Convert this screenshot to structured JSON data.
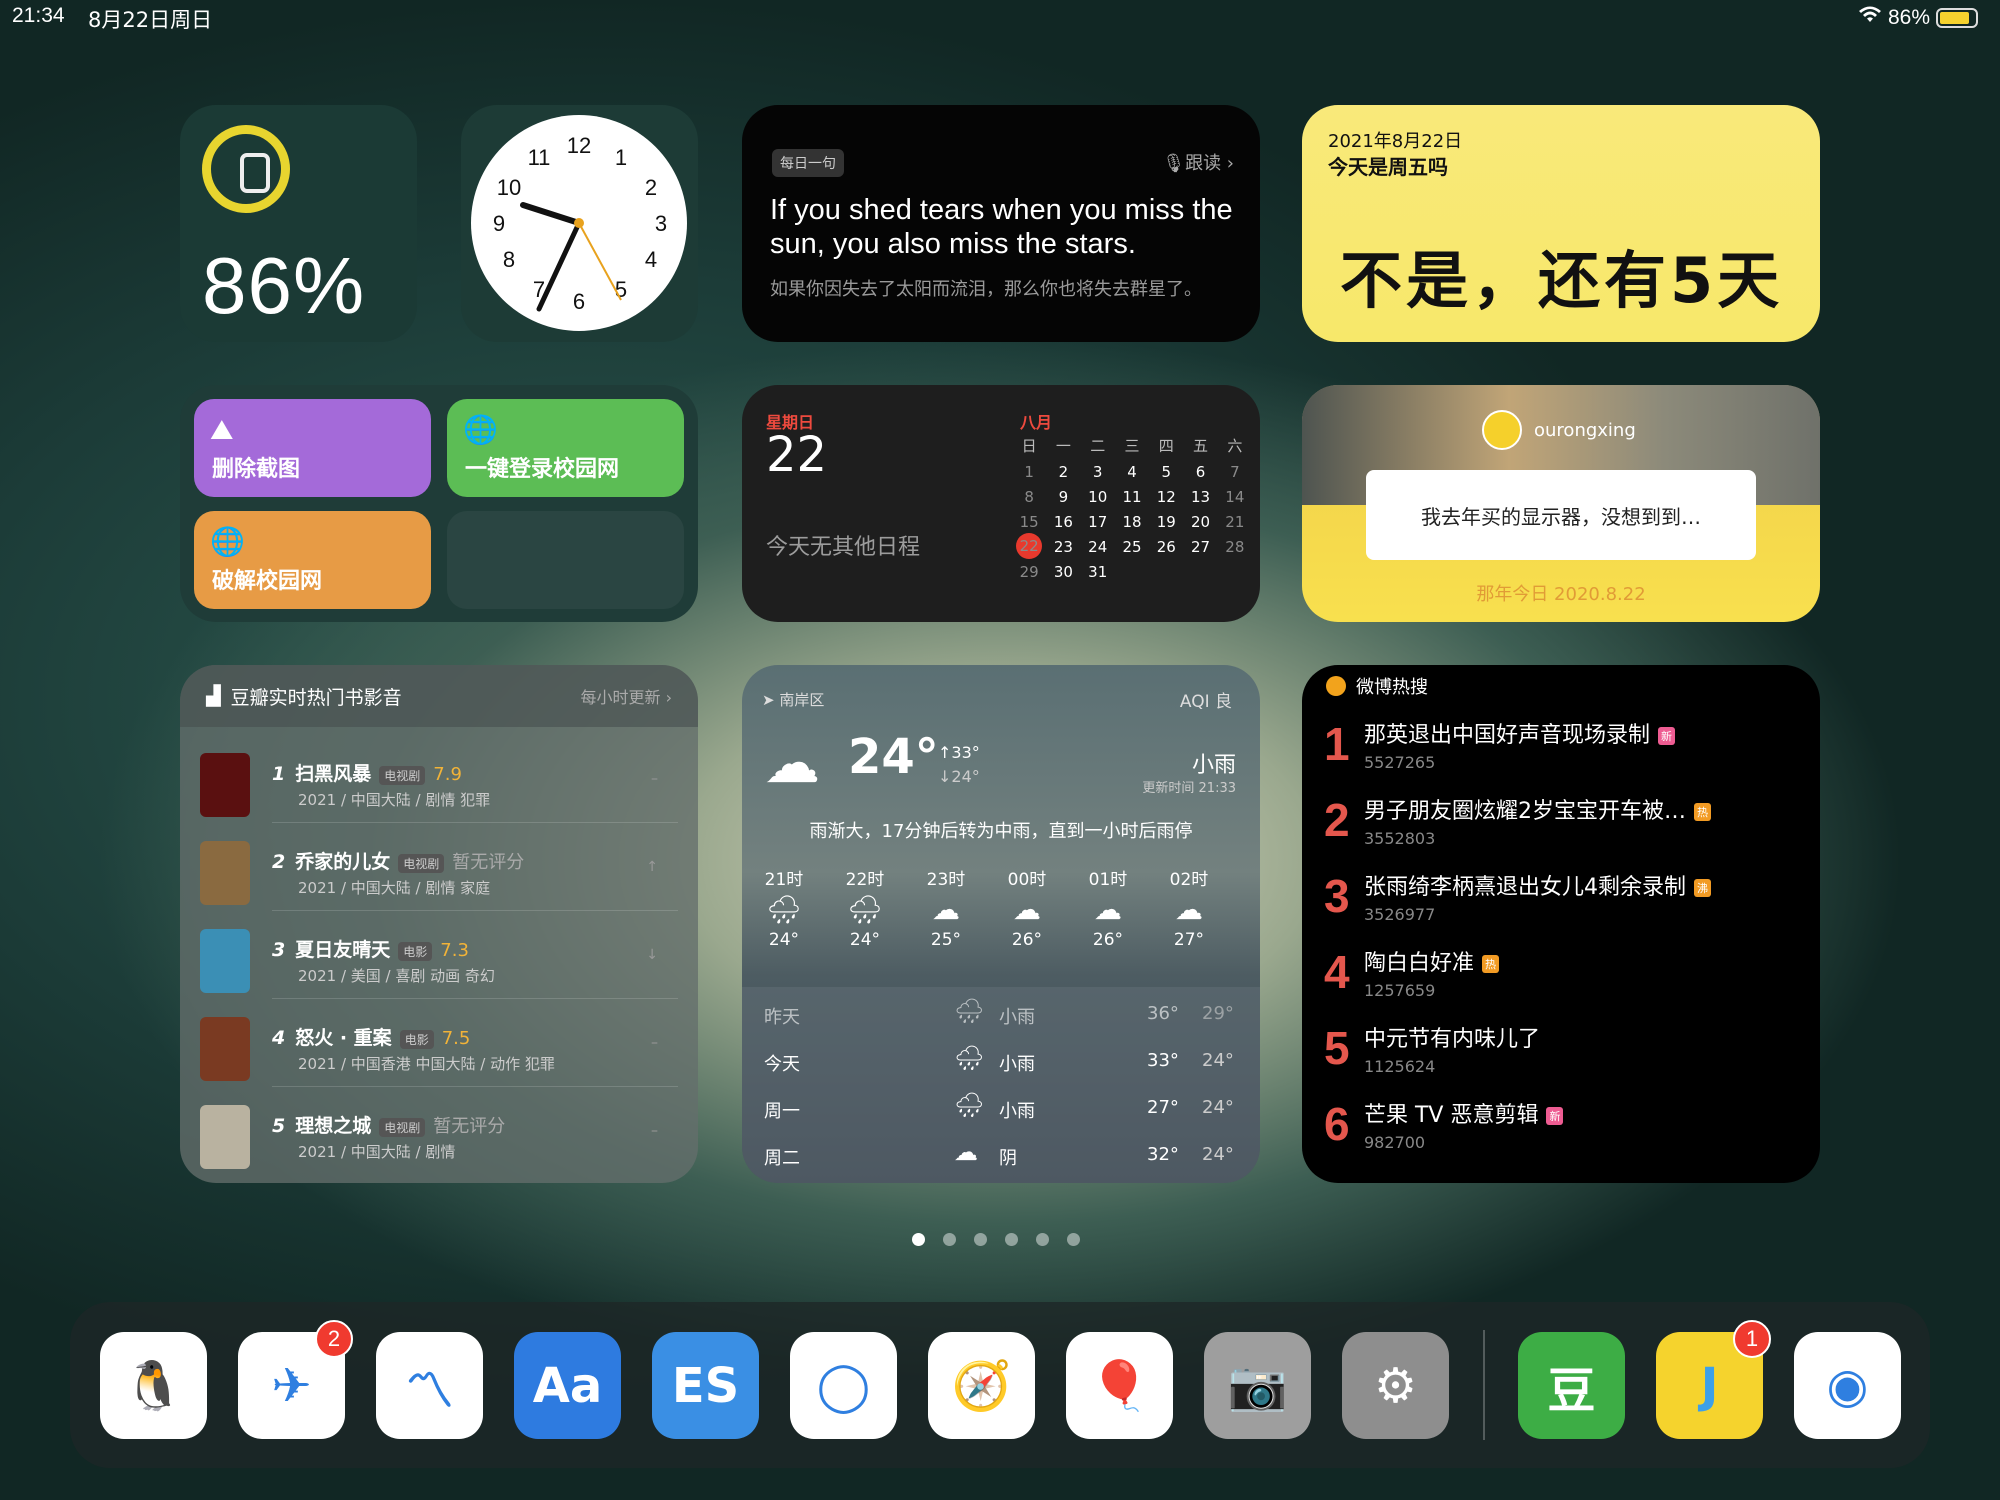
{
  "status": {
    "time": "21:34",
    "date": "8月22日周日",
    "battery": "86%"
  },
  "battery_widget": {
    "percent": "86%",
    "level": 0.86
  },
  "quote_widget": {
    "tag": "每日一句",
    "follow": "跟读 ›",
    "english": "If you shed tears when you miss the sun, you also miss the stars.",
    "chinese": "如果你因失去了太阳而流泪，那么你也将失去群星了。"
  },
  "friday_widget": {
    "date": "2021年8月22日",
    "question": "今天是周五吗",
    "answer": "不是，还有5天"
  },
  "shortcuts": [
    {
      "label": "删除截图",
      "icon": "mountain-icon",
      "color": "#a46ad9"
    },
    {
      "label": "一键登录校园网",
      "icon": "globe-icon",
      "color": "#5cbd55"
    },
    {
      "label": "破解校园网",
      "icon": "globe-icon",
      "color": "#e79b45"
    }
  ],
  "calendar": {
    "weekday": "星期日",
    "day": "22",
    "no_events": "今天无其他日程",
    "month": "八月",
    "headers": [
      "日",
      "一",
      "二",
      "三",
      "四",
      "五",
      "六"
    ],
    "days": [
      "1",
      "2",
      "3",
      "4",
      "5",
      "6",
      "7",
      "8",
      "9",
      "10",
      "11",
      "12",
      "13",
      "14",
      "15",
      "16",
      "17",
      "18",
      "19",
      "20",
      "21",
      "22",
      "23",
      "24",
      "25",
      "26",
      "27",
      "28",
      "29",
      "30",
      "31"
    ],
    "today": "22"
  },
  "photo_widget": {
    "user": "ourongxing",
    "text": "我去年买的显示器，没想到到…",
    "footer": "那年今日 2020.8.22"
  },
  "douban": {
    "title": "豆瓣实时热门书影音",
    "update": "每小时更新 ›",
    "items": [
      {
        "rank": "1",
        "title": "扫黑风暴",
        "type": "电视剧",
        "score": "7.9",
        "sub": "2021 / 中国大陆 / 剧情 犯罪",
        "trend": "–",
        "color": "#5a1010"
      },
      {
        "rank": "2",
        "title": "乔家的儿女",
        "type": "电视剧",
        "score": "暂无评分",
        "sub": "2021 / 中国大陆 / 剧情 家庭",
        "trend": "↑",
        "color": "#8a6a40"
      },
      {
        "rank": "3",
        "title": "夏日友晴天",
        "type": "电影",
        "score": "7.3",
        "sub": "2021 / 美国 / 喜剧 动画 奇幻",
        "trend": "↓",
        "color": "#3b8fb5"
      },
      {
        "rank": "4",
        "title": "怒火 · 重案",
        "type": "电影",
        "score": "7.5",
        "sub": "2021 / 中国香港 中国大陆 / 动作 犯罪",
        "trend": "–",
        "color": "#7a3a22"
      },
      {
        "rank": "5",
        "title": "理想之城",
        "type": "电视剧",
        "score": "暂无评分",
        "sub": "2021 / 中国大陆 / 剧情",
        "trend": "–",
        "color": "#b9b2a0"
      }
    ]
  },
  "weather": {
    "location": "南岸区",
    "aqi": "AQI 良",
    "temp": "24°",
    "high": "↑33°",
    "low": "↓24°",
    "condition": "小雨",
    "updated": "更新时间 21:33",
    "description": "雨渐大，17分钟后转为中雨，直到一小时后雨停",
    "hourly": [
      {
        "time": "21时",
        "temp": "24°",
        "icon": "rain-icon"
      },
      {
        "time": "22时",
        "temp": "24°",
        "icon": "rain-icon"
      },
      {
        "time": "23时",
        "temp": "25°",
        "icon": "cloud-icon"
      },
      {
        "time": "00时",
        "temp": "26°",
        "icon": "cloud-icon"
      },
      {
        "time": "01时",
        "temp": "26°",
        "icon": "cloud-icon"
      },
      {
        "time": "02时",
        "temp": "27°",
        "icon": "cloud-icon"
      }
    ],
    "daily": [
      {
        "name": "昨天",
        "cond": "小雨",
        "high": "36°",
        "low": "29°",
        "icon": "rain-icon"
      },
      {
        "name": "今天",
        "cond": "小雨",
        "high": "33°",
        "low": "24°",
        "icon": "rain-icon"
      },
      {
        "name": "周一",
        "cond": "小雨",
        "high": "27°",
        "low": "24°",
        "icon": "rain-icon"
      },
      {
        "name": "周二",
        "cond": "阴",
        "high": "32°",
        "low": "24°",
        "icon": "cloud-icon"
      }
    ]
  },
  "weibo": {
    "title": "微博热搜",
    "items": [
      {
        "rank": "1",
        "title": "那英退出中国好声音现场录制",
        "tag": "新",
        "tag_color": "#ee5c92",
        "count": "5527265"
      },
      {
        "rank": "2",
        "title": "男子朋友圈炫耀2岁宝宝开车被…",
        "tag": "热",
        "tag_color": "#f29b24",
        "count": "3552803"
      },
      {
        "rank": "3",
        "title": "张雨绮李柄熹退出女儿4剩余录制",
        "tag": "沸",
        "tag_color": "#f29b24",
        "count": "3526977"
      },
      {
        "rank": "4",
        "title": "陶白白好准",
        "tag": "热",
        "tag_color": "#f29b24",
        "count": "1257659"
      },
      {
        "rank": "5",
        "title": "中元节有内味儿了",
        "tag": "",
        "tag_color": "",
        "count": "1125624"
      },
      {
        "rank": "6",
        "title": "芒果 TV 恶意剪辑",
        "tag": "新",
        "tag_color": "#ee5c92",
        "count": "982700"
      }
    ]
  },
  "page_dots": {
    "count": 6,
    "active": 0
  },
  "dock": [
    {
      "name": "qq-app",
      "icon": "penguin-icon",
      "bg": "#ffffff",
      "glyph": "🐧",
      "badge": ""
    },
    {
      "name": "telegram-app",
      "icon": "paper-plane-icon",
      "bg": "#ffffff",
      "glyph": "✈",
      "badge": "2"
    },
    {
      "name": "app-3",
      "icon": "m-logo-icon",
      "bg": "#ffffff",
      "glyph": "〽",
      "badge": ""
    },
    {
      "name": "dictionary-app",
      "icon": "aa-search-icon",
      "bg": "#2e7be0",
      "glyph": "Aa",
      "badge": ""
    },
    {
      "name": "es-file-app",
      "icon": "folder-cloud-icon",
      "bg": "#3a8fe4",
      "glyph": "ES",
      "badge": ""
    },
    {
      "name": "app-6",
      "icon": "ring-icon",
      "bg": "#ffffff",
      "glyph": "◯",
      "badge": ""
    },
    {
      "name": "safari-app",
      "icon": "compass-icon",
      "bg": "#ffffff",
      "glyph": "🧭",
      "badge": ""
    },
    {
      "name": "app-8",
      "icon": "balloon-icon",
      "bg": "#ffffff",
      "glyph": "🎈",
      "badge": ""
    },
    {
      "name": "camera-app",
      "icon": "camera-icon",
      "bg": "#9e9e9e",
      "glyph": "📷",
      "badge": ""
    },
    {
      "name": "settings-app",
      "icon": "gear-icon",
      "bg": "#8e8e8e",
      "glyph": "⚙",
      "badge": ""
    },
    {
      "name": "douban-app",
      "icon": "douban-icon",
      "bg": "#3dad45",
      "glyph": "豆",
      "badge": ""
    },
    {
      "name": "app-12",
      "icon": "j-icon",
      "bg": "#f5d32d",
      "glyph": "J",
      "badge": "1"
    },
    {
      "name": "weibo-app",
      "icon": "weibo-icon",
      "bg": "#ffffff",
      "glyph": "◉",
      "badge": ""
    }
  ]
}
